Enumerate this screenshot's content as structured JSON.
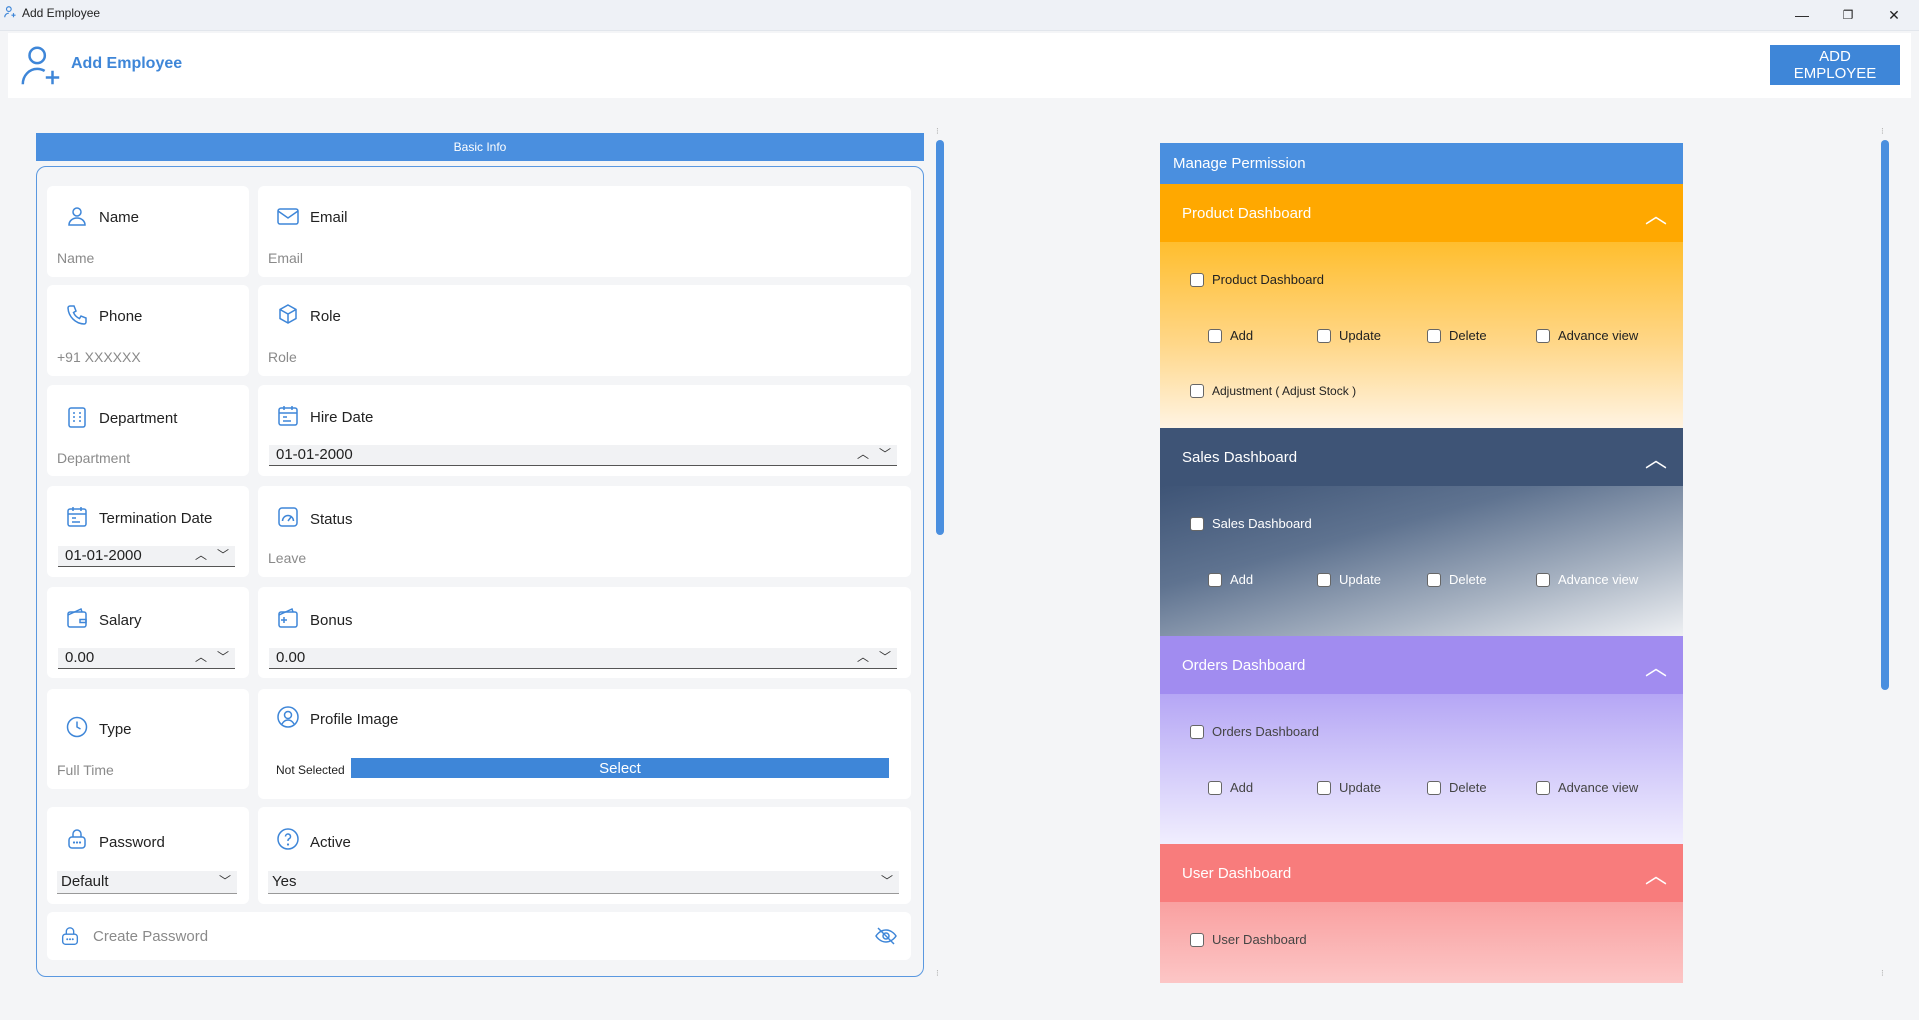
{
  "window": {
    "title": "Add Employee",
    "minimize": "—",
    "maximize": "❐",
    "close": "✕"
  },
  "header": {
    "title": "Add Employee",
    "add_button": "ADD EMPLOYEE"
  },
  "basic_info": {
    "section_label": "Basic Info",
    "name": {
      "label": "Name",
      "placeholder": "Name"
    },
    "email": {
      "label": "Email",
      "placeholder": "Email"
    },
    "phone": {
      "label": "Phone",
      "placeholder": "+91 XXXXXX"
    },
    "role": {
      "label": "Role",
      "placeholder": "Role"
    },
    "department": {
      "label": "Department",
      "placeholder": "Department"
    },
    "hire_date": {
      "label": "Hire Date",
      "value": "01-01-2000"
    },
    "termination_date": {
      "label": "Termination Date",
      "value": "01-01-2000"
    },
    "status": {
      "label": "Status",
      "value": "Leave"
    },
    "salary": {
      "label": "Salary",
      "value": "0.00"
    },
    "bonus": {
      "label": "Bonus",
      "value": "0.00"
    },
    "type": {
      "label": "Type",
      "value": "Full Time"
    },
    "profile_image": {
      "label": "Profile Image",
      "status": "Not Selected",
      "button": "Select"
    },
    "password": {
      "label": "Password",
      "value": "Default"
    },
    "active": {
      "label": "Active",
      "value": "Yes"
    },
    "create_password": {
      "placeholder": "Create Password"
    }
  },
  "permissions": {
    "title": "Manage Permission",
    "product": {
      "header": "Product Dashboard",
      "main": "Product Dashboard",
      "add": "Add",
      "update": "Update",
      "delete": "Delete",
      "advance": "Advance view",
      "adjustment": "Adjustment ( Adjust Stock )",
      "color": "#ffa800"
    },
    "sales": {
      "header": "Sales Dashboard",
      "main": "Sales Dashboard",
      "add": "Add",
      "update": "Update",
      "delete": "Delete",
      "advance": "Advance view",
      "color": "#3e5476"
    },
    "orders": {
      "header": "Orders Dashboard",
      "main": "Orders Dashboard",
      "add": "Add",
      "update": "Update",
      "delete": "Delete",
      "advance": "Advance view",
      "color": "#a18cf0"
    },
    "user": {
      "header": "User Dashboard",
      "main": "User Dashboard",
      "color": "#f87c7c"
    }
  }
}
